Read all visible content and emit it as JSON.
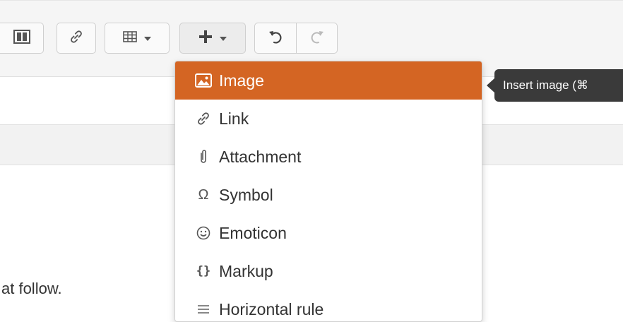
{
  "toolbar": {
    "layout_icon": "columns-icon",
    "link_icon": "link-icon",
    "table_icon": "table-icon",
    "insert_icon": "plus-icon",
    "undo_icon": "undo-icon",
    "redo_icon": "redo-icon"
  },
  "insert_menu": {
    "items": [
      {
        "label": "Image",
        "icon": "image-icon",
        "selected": true
      },
      {
        "label": "Link",
        "icon": "link-icon"
      },
      {
        "label": "Attachment",
        "icon": "paperclip-icon"
      },
      {
        "label": "Symbol",
        "icon": "omega-icon"
      },
      {
        "label": "Emoticon",
        "icon": "smiley-icon"
      },
      {
        "label": "Markup",
        "icon": "braces-icon"
      },
      {
        "label": "Horizontal rule",
        "icon": "horizontal-rule-icon"
      }
    ]
  },
  "tooltip": {
    "text": "Insert image (⌘"
  },
  "editor": {
    "visible_text": "at follow."
  },
  "colors": {
    "accent": "#d46523",
    "tooltip_bg": "#3a3a3a"
  }
}
